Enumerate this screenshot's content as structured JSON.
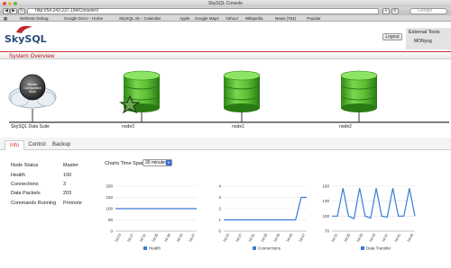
{
  "window": {
    "title": "SkySQL Console"
  },
  "browser": {
    "url": "http://54.243.237.194/ConsoleV",
    "search_placeholder": "Google",
    "bookmarks": [
      "NetGear Debug",
      "Google Docs – Home",
      "SkySQL Ab – Calendar",
      "Apple",
      "Google Maps",
      "Yahoo!",
      "Wikipedia",
      "News (764)",
      "Popular"
    ]
  },
  "header": {
    "logo": "SkySQL",
    "logout_label": "Logout",
    "external_tools_label": "External Tools",
    "monyog_label": "MONyog"
  },
  "overview": {
    "title": "System Overview",
    "nodes": [
      {
        "label": "SkySQL Data Suite",
        "icon": "cloud-server-icon"
      },
      {
        "label": "node3",
        "icon": "database-icon",
        "badge": "star-icon"
      },
      {
        "label": "node1",
        "icon": "database-icon"
      },
      {
        "label": "node2",
        "icon": "database-icon"
      }
    ],
    "suite_badge": "Monitor Configuration Node"
  },
  "tabs": [
    "Info",
    "Control",
    "Backup"
  ],
  "info": {
    "rows": [
      {
        "label": "Node Status",
        "value": "Master"
      },
      {
        "label": "Health",
        "value": "100"
      },
      {
        "label": "Connections",
        "value": "3"
      },
      {
        "label": "Data Packets",
        "value": "203"
      },
      {
        "label": "Commands Running",
        "value": "Promote"
      }
    ],
    "timespan_label": "Charts Time Span",
    "timespan_value": "30 minutes"
  },
  "colors": {
    "accent": "#cc3333",
    "series": "#3a7bd5",
    "db_green": "#4caf2a"
  },
  "chart_data": [
    {
      "type": "line",
      "x": [
        "16:23",
        "16:27",
        "16:31",
        "16:35",
        "16:39",
        "16:43",
        "16:47"
      ],
      "ylim": [
        0,
        200
      ],
      "yticks": [
        0,
        50,
        100,
        150,
        200
      ],
      "series": [
        {
          "name": "Health",
          "values": [
            100,
            100,
            100,
            100,
            100,
            100,
            100,
            100,
            100,
            100,
            100,
            100,
            100,
            100,
            100,
            100
          ]
        }
      ]
    },
    {
      "type": "line",
      "x": [
        "16:23",
        "16:27",
        "16:31",
        "16:35",
        "16:39",
        "16:43",
        "16:47"
      ],
      "ylim": [
        0,
        4
      ],
      "yticks": [
        0,
        1,
        2,
        3,
        4
      ],
      "series": [
        {
          "name": "Connections",
          "values": [
            1,
            1,
            1,
            1,
            1,
            1,
            1,
            1,
            1,
            1,
            1,
            1,
            1,
            1,
            3,
            3
          ]
        }
      ]
    },
    {
      "type": "line",
      "x": [
        "16:21",
        "16:25",
        "16:29",
        "16:33",
        "16:37",
        "16:41",
        "16:45"
      ],
      "ylim": [
        70,
        160
      ],
      "yticks": [
        70,
        100,
        130,
        160
      ],
      "series": [
        {
          "name": "Data Transfer",
          "values": [
            100,
            100,
            156,
            100,
            95,
            156,
            100,
            96,
            156,
            100,
            98,
            156,
            100,
            100,
            156,
            100
          ]
        }
      ]
    }
  ]
}
